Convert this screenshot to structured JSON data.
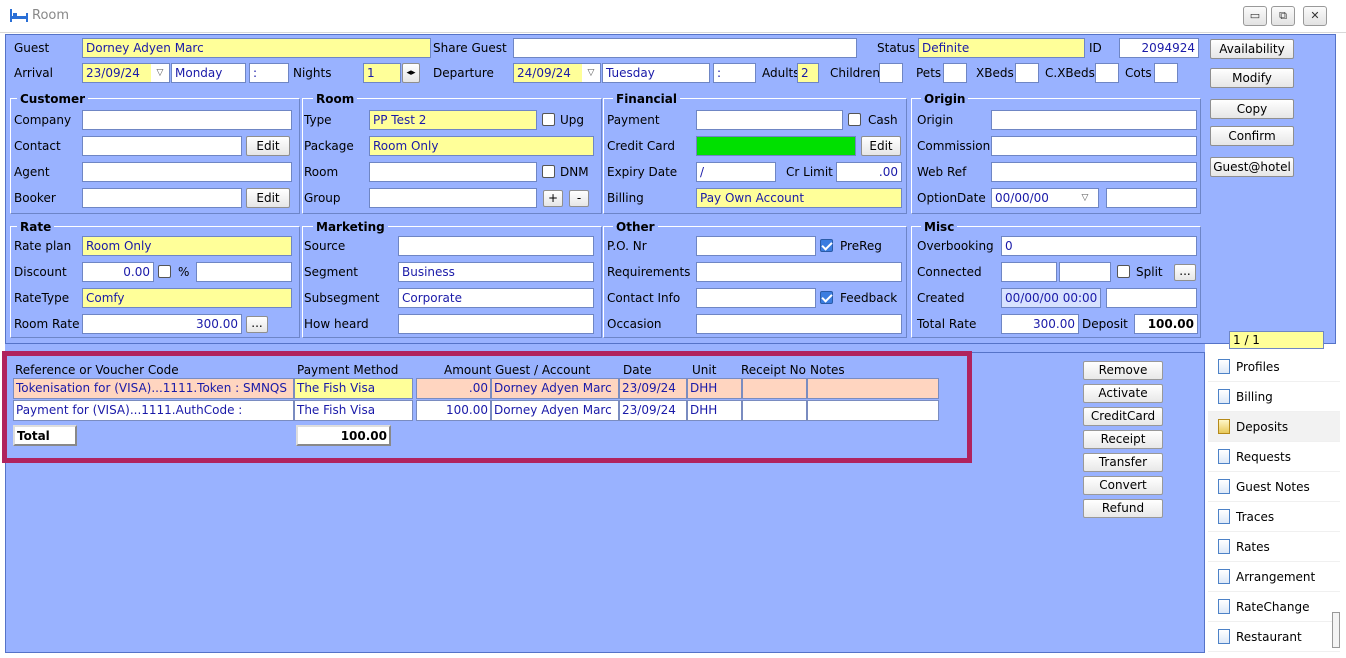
{
  "window": {
    "title": "Room",
    "controls": [
      "▭",
      "⧉",
      "✕"
    ]
  },
  "guest": {
    "guest_label": "Guest",
    "guest_value": "Dorney Adyen Marc",
    "share_label": "Share Guest",
    "share_value": "",
    "status_label": "Status",
    "status_value": "Definite",
    "id_label": "ID",
    "id_value": "2094924",
    "arrival_label": "Arrival",
    "arrival_date": "23/09/24",
    "arrival_day": "Monday",
    "arrival_time": ":",
    "nights_label": "Nights",
    "nights_value": "1",
    "departure_label": "Departure",
    "departure_date": "24/09/24",
    "departure_day": "Tuesday",
    "departure_time": ":",
    "adults_label": "Adults",
    "adults_value": "2",
    "children_label": "Children",
    "pets_label": "Pets",
    "xbeds_label": "XBeds",
    "cxbeds_label": "C.XBeds",
    "cots_label": "Cots"
  },
  "actions": [
    "Availability",
    "Modify",
    "Copy",
    "Confirm",
    "Guest@hotel"
  ],
  "customer": {
    "title": "Customer",
    "company": "Company",
    "contact": "Contact",
    "agent": "Agent",
    "booker": "Booker",
    "edit": "Edit"
  },
  "room": {
    "title": "Room",
    "type_label": "Type",
    "type_value": "PP Test 2",
    "upg": "Upg",
    "package_label": "Package",
    "package_value": "Room Only",
    "room_label": "Room",
    "dnm": "DNM",
    "group_label": "Group",
    "plus": "+",
    "minus": "-"
  },
  "financial": {
    "title": "Financial",
    "payment": "Payment",
    "cash": "Cash",
    "credit_card": "Credit Card",
    "edit": "Edit",
    "expiry": "Expiry Date",
    "expiry_value": "/",
    "cr_limit": "Cr Limit",
    "cr_limit_value": ".00",
    "billing": "Billing",
    "billing_value": "Pay Own Account"
  },
  "origin": {
    "title": "Origin",
    "origin": "Origin",
    "commission": "Commission",
    "webref": "Web Ref",
    "optiondate": "OptionDate",
    "optiondate_value": "00/00/00"
  },
  "rate": {
    "title": "Rate",
    "plan_label": "Rate plan",
    "plan_value": "Room Only",
    "discount_label": "Discount",
    "discount_value": "0.00",
    "pct": "%",
    "ratetype_label": "RateType",
    "ratetype_value": "Comfy",
    "roomrate_label": "Room Rate",
    "roomrate_value": "300.00",
    "more": "..."
  },
  "marketing": {
    "title": "Marketing",
    "source": "Source",
    "segment": "Segment",
    "segment_value": "Business",
    "subsegment": "Subsegment",
    "subsegment_value": "Corporate",
    "howheard": "How heard"
  },
  "other": {
    "title": "Other",
    "po": "P.O. Nr",
    "prereg": "PreReg",
    "requirements": "Requirements",
    "contactinfo": "Contact Info",
    "feedback": "Feedback",
    "occasion": "Occasion"
  },
  "misc": {
    "title": "Misc",
    "overbooking": "Overbooking",
    "overbooking_value": "0",
    "connected": "Connected",
    "split": "Split",
    "more": "...",
    "created": "Created",
    "created_value": "00/00/00 00:00",
    "totalrate": "Total Rate",
    "totalrate_value": "300.00",
    "deposit": "Deposit",
    "deposit_value": "100.00"
  },
  "pager": "1 / 1",
  "deposits": {
    "headers": [
      "Reference or Voucher Code",
      "Payment Method",
      "Amount",
      "Guest / Account",
      "Date",
      "Unit",
      "Receipt No",
      "Notes"
    ],
    "rows": [
      {
        "ref": "Tokenisation for (VISA)...1111.Token : SMNQS",
        "method": "The Fish Visa",
        "amount": ".00",
        "guest": "Dorney Adyen Marc",
        "date": "23/09/24",
        "unit": "DHH",
        "receipt": "",
        "notes": ""
      },
      {
        "ref": "Payment for (VISA)...1111.AuthCode :",
        "method": "The Fish Visa",
        "amount": "100.00",
        "guest": "Dorney Adyen Marc",
        "date": "23/09/24",
        "unit": "DHH",
        "receipt": "",
        "notes": ""
      }
    ],
    "total_label": "Total",
    "total_value": "100.00"
  },
  "deposit_actions": [
    "Remove",
    "Activate",
    "CreditCard",
    "Receipt",
    "Transfer",
    "Convert",
    "Refund"
  ],
  "tabs": [
    "Profiles",
    "Billing",
    "Deposits",
    "Requests",
    "Guest Notes",
    "Traces",
    "Rates",
    "Arrangement",
    "RateChange",
    "Restaurant"
  ],
  "colors": {
    "panel": "#99b2ff",
    "required": "#ffff99",
    "highlight": "#b0235e",
    "card_ok": "#00e000"
  }
}
